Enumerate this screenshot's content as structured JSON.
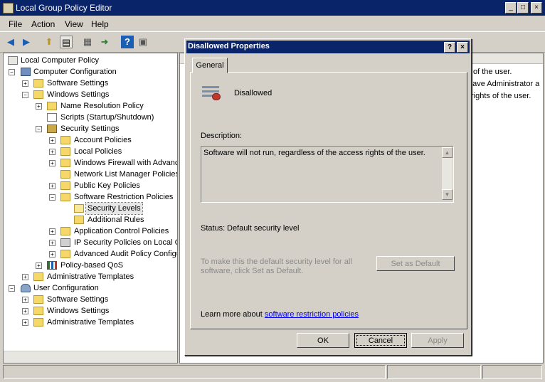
{
  "window": {
    "title": "Local Group Policy Editor",
    "buttons": {
      "minimize": "_",
      "maximize": "□",
      "close": "×"
    }
  },
  "menu": [
    "File",
    "Action",
    "View",
    "Help"
  ],
  "tree": [
    {
      "label": "Local Computer Policy",
      "icon": "policy-icon"
    },
    {
      "label": "Computer Configuration",
      "icon": "computer-icon"
    },
    {
      "label": "Software Settings",
      "icon": "folder-icon"
    },
    {
      "label": "Windows Settings",
      "icon": "folder-icon"
    },
    {
      "label": "Name Resolution Policy",
      "icon": "folder-icon"
    },
    {
      "label": "Scripts (Startup/Shutdown)",
      "icon": "scripts-icon"
    },
    {
      "label": "Security Settings",
      "icon": "security-icon"
    },
    {
      "label": "Account Policies",
      "icon": "folder-icon"
    },
    {
      "label": "Local Policies",
      "icon": "folder-icon"
    },
    {
      "label": "Windows Firewall with Advanc",
      "icon": "folder-icon"
    },
    {
      "label": "Network List Manager Policies",
      "icon": "folder-icon"
    },
    {
      "label": "Public Key Policies",
      "icon": "folder-icon"
    },
    {
      "label": "Software Restriction Policies",
      "icon": "folder-icon"
    },
    {
      "label": "Security Levels",
      "icon": "folder-open-icon"
    },
    {
      "label": "Additional Rules",
      "icon": "folder-icon"
    },
    {
      "label": "Application Control Policies",
      "icon": "folder-icon"
    },
    {
      "label": "IP Security Policies on Local Co",
      "icon": "ipsec-icon"
    },
    {
      "label": "Advanced Audit Policy Configu",
      "icon": "folder-icon"
    },
    {
      "label": "Policy-based QoS",
      "icon": "chart-icon"
    },
    {
      "label": "Administrative Templates",
      "icon": "folder-icon"
    },
    {
      "label": "User Configuration",
      "icon": "user-icon"
    },
    {
      "label": "Software Settings",
      "icon": "folder-icon"
    },
    {
      "label": "Windows Settings",
      "icon": "folder-icon"
    },
    {
      "label": "Administrative Templates",
      "icon": "folder-icon"
    }
  ],
  "right_pane_lines": [
    "of the user.",
    "have Administrator a",
    "rights of the user."
  ],
  "dialog": {
    "title": "Disallowed Properties",
    "help_button": "?",
    "close_button": "×",
    "tab": "General",
    "level_name": "Disallowed",
    "description_label": "Description:",
    "description_text": "Software will not run, regardless of the access rights of the user.",
    "status_label": "Status:",
    "status_value": "Default security level",
    "default_hint": "To make this the default security level for all software, click Set as Default.",
    "set_default_button": "Set as Default",
    "learn_more_prefix": "Learn more about ",
    "learn_more_link": "software restriction policies",
    "ok_button": "OK",
    "cancel_button": "Cancel",
    "apply_button": "Apply"
  }
}
